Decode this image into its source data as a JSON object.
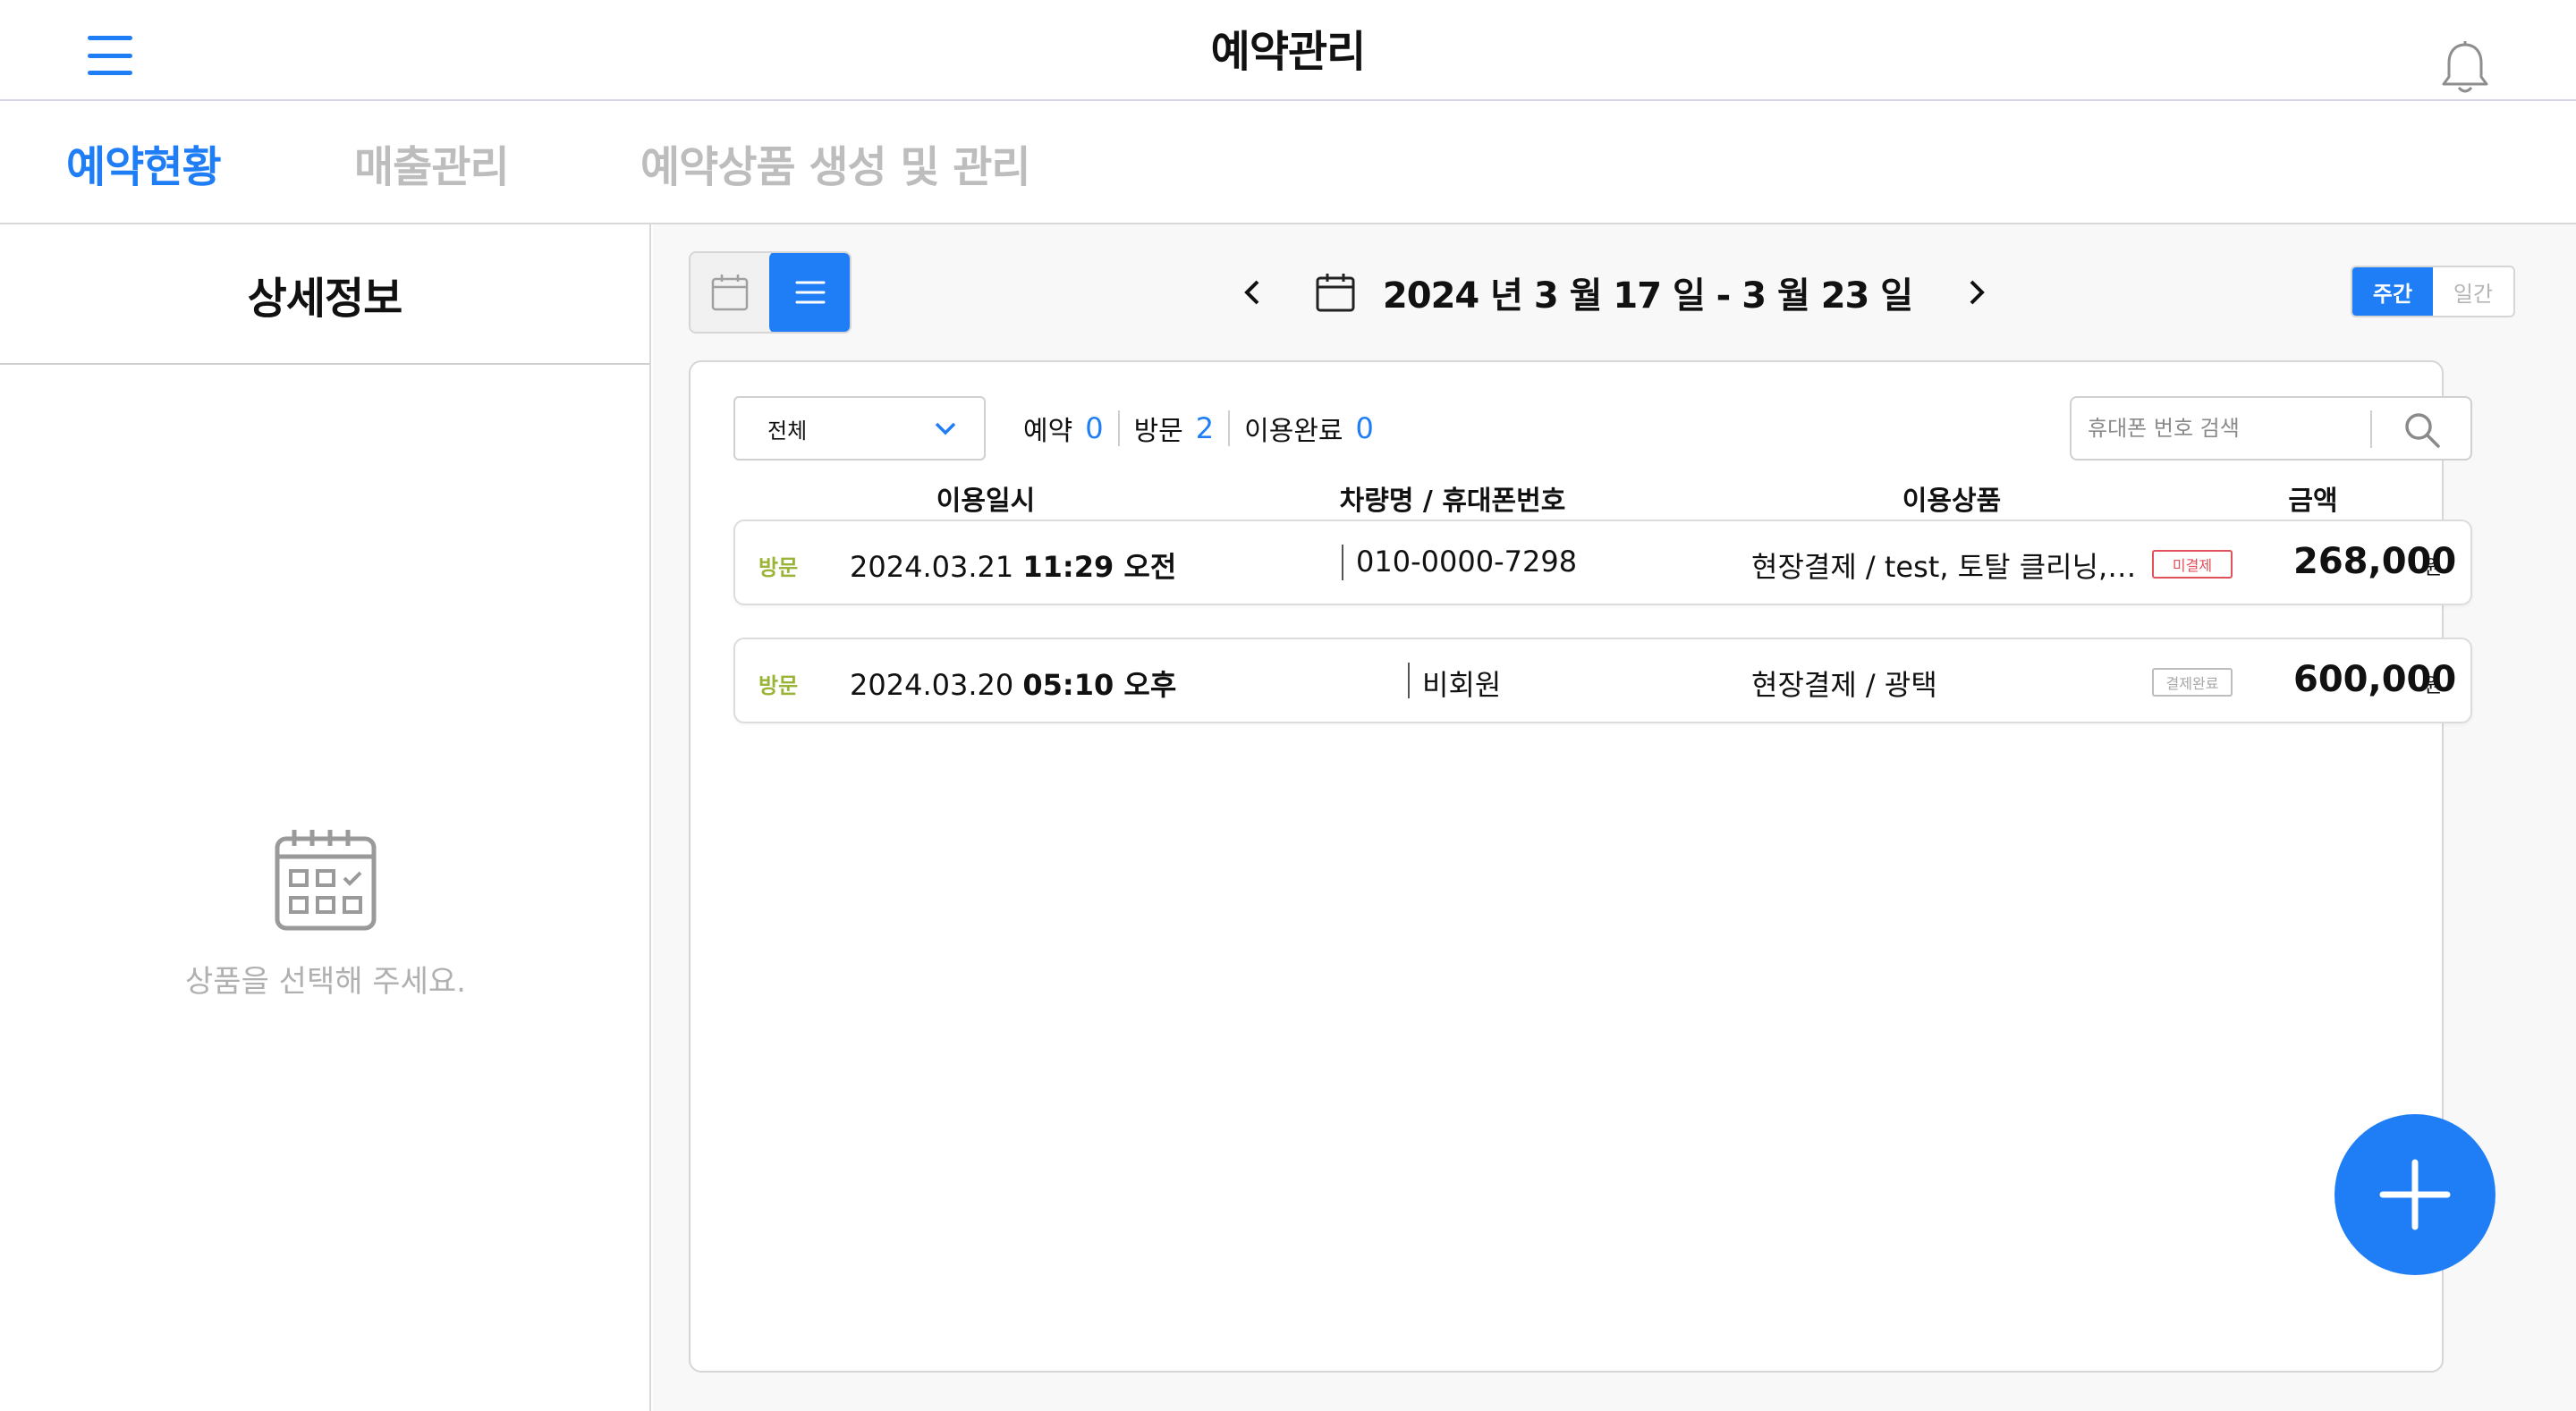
{
  "header": {
    "title": "예약관리",
    "menu_icon": "hamburger-icon",
    "bell_icon": "bell-icon"
  },
  "tabs": [
    {
      "label": "예약현황",
      "active": true
    },
    {
      "label": "매출관리",
      "active": false
    },
    {
      "label": "예약상품 생성 및 관리",
      "active": false
    }
  ],
  "left_panel": {
    "title": "상세정보",
    "empty_icon": "calendar-check-icon",
    "empty_text": "상품을 선택해 주세요."
  },
  "toolbar": {
    "view_calendar_icon": "calendar-icon",
    "view_list_icon": "list-icon",
    "date_range": "2024 년  3 월  17 일 - 3 월  23 일",
    "prev_icon": "chevron-left-icon",
    "next_icon": "chevron-right-icon",
    "period_weekly": "주간",
    "period_daily": "일간",
    "period_selected": "주간"
  },
  "filters": {
    "select_value": "전체",
    "counts": [
      {
        "label": "예약",
        "value": "0"
      },
      {
        "label": "방문",
        "value": "2"
      },
      {
        "label": "이용완료",
        "value": "0"
      }
    ],
    "search_placeholder": "휴대폰 번호 검색"
  },
  "table": {
    "columns": [
      "이용일시",
      "차량명 / 휴대폰번호",
      "이용상품",
      "금액"
    ],
    "rows": [
      {
        "status": "방문",
        "date": "2024.03.21",
        "time": "11:29 오전",
        "phone": "010-0000-7298",
        "product": "현장결제 / test, 토탈 클리닝, 디테일링",
        "payment_badge": "미결제",
        "amount": "268,000",
        "unit": "원"
      },
      {
        "status": "방문",
        "date": "2024.03.20",
        "time": "05:10 오후",
        "phone": "비회원",
        "product": "현장결제 / 광택",
        "payment_badge": "결제완료",
        "amount": "600,000",
        "unit": "원"
      }
    ]
  },
  "fab": {
    "icon": "plus-icon"
  },
  "colors": {
    "accent": "#1f7ef6",
    "status_visit": "#9ab437",
    "unpaid": "#e0515a",
    "muted": "#bdbdbd"
  }
}
